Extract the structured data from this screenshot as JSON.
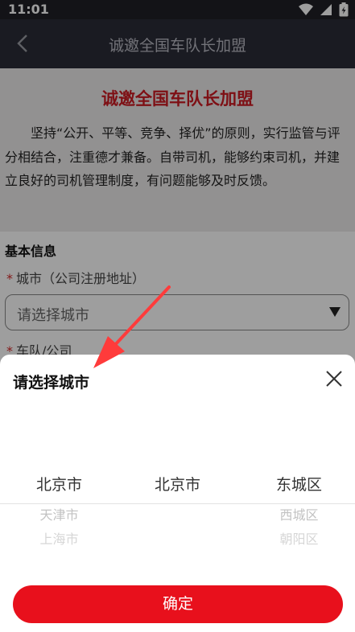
{
  "status_bar": {
    "time": "11:01"
  },
  "nav": {
    "title": "诚邀全国车队长加盟"
  },
  "hero": {
    "title": "诚邀全国车队长加盟",
    "intro": "坚持“公开、平等、竞争、择优”的原则，实行监管与评分相结合，注重德才兼备。自带司机，能够约束司机，并建立良好的司机管理制度，有问题能够及时反馈。"
  },
  "form": {
    "section_title": "基本信息",
    "required_mark": "*",
    "city_label": "城市（公司注册地址）",
    "city_placeholder": "请选择城市",
    "team_label": "车队/公司"
  },
  "sheet": {
    "title": "请选择城市",
    "province_column": [
      "北京市",
      "天津市",
      "上海市"
    ],
    "city_column": [
      "北京市"
    ],
    "district_column": [
      "东城区",
      "西城区",
      "朝阳区"
    ],
    "confirm_label": "确定"
  },
  "colors": {
    "accent": "#e8101c",
    "hero_title": "#cc1a22",
    "nav_bg": "#2b2d38"
  }
}
